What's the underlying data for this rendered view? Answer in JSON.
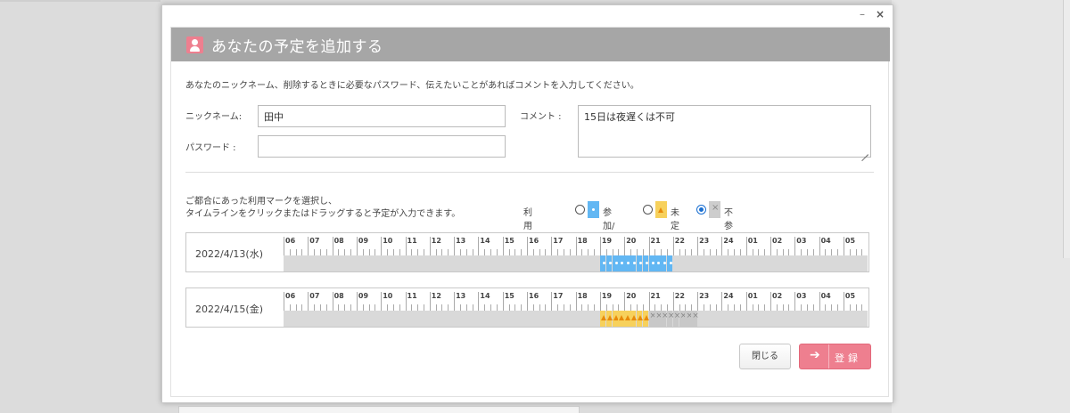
{
  "window": {
    "minimize_glyph": "–",
    "close_glyph": "×"
  },
  "header": {
    "title": "あなたの予定を追加する",
    "icon": "user-icon"
  },
  "description": "あなたのニックネーム、削除するときに必要なパスワード、伝えたいことがあればコメントを入力してください。",
  "form": {
    "nickname_label": "ニックネーム:",
    "nickname_value": "田中",
    "password_label": "パスワード  :",
    "password_value": "",
    "comment_label": "コメント  :",
    "comment_value": "15日は夜遅くは不可"
  },
  "instructions": {
    "line1": "ご都合にあった利用マークを選択し、",
    "line2": "タイムラインをクリックまたはドラッグすると予定が入力できます。"
  },
  "marks": {
    "label": "利用マーク:",
    "options": [
      {
        "label": "参加/可",
        "selected": false,
        "color": "#62b7f3",
        "icon": "dot"
      },
      {
        "label": "未定",
        "selected": false,
        "color": "#f7d15c",
        "icon": "triangle"
      },
      {
        "label": "不参加/不可",
        "selected": true,
        "color": "#cdcdcd",
        "icon": "cross"
      }
    ]
  },
  "hours": [
    "06",
    "07",
    "08",
    "09",
    "10",
    "11",
    "12",
    "13",
    "14",
    "15",
    "16",
    "17",
    "18",
    "19",
    "20",
    "21",
    "22",
    "23",
    "24",
    "01",
    "02",
    "03",
    "04",
    "05"
  ],
  "timelines": [
    {
      "date": "2022/4/13(水)",
      "slots": [
        {
          "hour": "19",
          "q": 1,
          "mark": "blue"
        },
        {
          "hour": "19",
          "q": 2,
          "mark": "blue"
        },
        {
          "hour": "19",
          "q": 3,
          "mark": "blue"
        },
        {
          "hour": "19",
          "q": 4,
          "mark": "blue"
        },
        {
          "hour": "20",
          "q": 1,
          "mark": "blue"
        },
        {
          "hour": "20",
          "q": 2,
          "mark": "blue"
        },
        {
          "hour": "20",
          "q": 3,
          "mark": "blue"
        },
        {
          "hour": "20",
          "q": 4,
          "mark": "blue"
        },
        {
          "hour": "21",
          "q": 1,
          "mark": "blue"
        },
        {
          "hour": "21",
          "q": 2,
          "mark": "blue"
        },
        {
          "hour": "21",
          "q": 3,
          "mark": "blue"
        },
        {
          "hour": "21",
          "q": 4,
          "mark": "blue"
        }
      ]
    },
    {
      "date": "2022/4/15(金)",
      "slots": [
        {
          "hour": "19",
          "q": 1,
          "mark": "yellow"
        },
        {
          "hour": "19",
          "q": 2,
          "mark": "yellow"
        },
        {
          "hour": "19",
          "q": 3,
          "mark": "yellow"
        },
        {
          "hour": "19",
          "q": 4,
          "mark": "yellow"
        },
        {
          "hour": "20",
          "q": 1,
          "mark": "yellow"
        },
        {
          "hour": "20",
          "q": 2,
          "mark": "yellow"
        },
        {
          "hour": "20",
          "q": 3,
          "mark": "yellow"
        },
        {
          "hour": "20",
          "q": 4,
          "mark": "yellow"
        },
        {
          "hour": "21",
          "q": 1,
          "mark": "gray"
        },
        {
          "hour": "21",
          "q": 2,
          "mark": "gray"
        },
        {
          "hour": "21",
          "q": 3,
          "mark": "gray"
        },
        {
          "hour": "21",
          "q": 4,
          "mark": "gray"
        },
        {
          "hour": "22",
          "q": 1,
          "mark": "gray"
        },
        {
          "hour": "22",
          "q": 2,
          "mark": "gray"
        },
        {
          "hour": "22",
          "q": 3,
          "mark": "gray"
        },
        {
          "hour": "22",
          "q": 4,
          "mark": "gray"
        }
      ]
    }
  ],
  "buttons": {
    "close_label": "閉じる",
    "register_label": "登録",
    "register_icon": "arrow-right-icon"
  }
}
